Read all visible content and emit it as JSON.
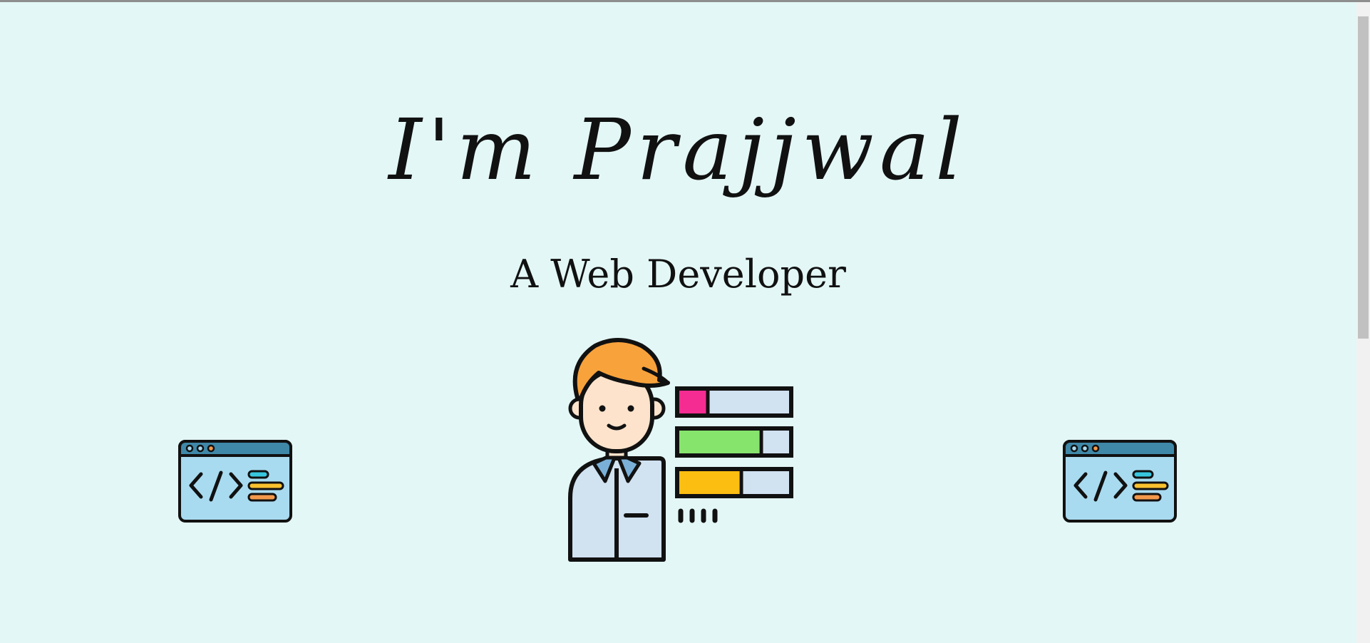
{
  "hero": {
    "title": "I'm Prajjwal",
    "subtitle": "A Web Developer"
  },
  "icons": {
    "left": "code-window-icon",
    "right": "code-window-icon",
    "center": "web-developer-illustration"
  },
  "colors": {
    "background": "#e3f7f6",
    "window_header": "#3f88a8",
    "window_body": "#a9dbf0",
    "hair": "#f8a23c",
    "skin": "#fde3cc",
    "shirt": "#d1e2f1",
    "bar_pink": "#f52c91",
    "bar_green": "#86e46d",
    "bar_yellow": "#fdbe12",
    "bar_empty": "#d1e2f1",
    "line_cyan": "#38c6df",
    "line_yellow": "#f9c12e",
    "line_orange": "#f3994b"
  }
}
